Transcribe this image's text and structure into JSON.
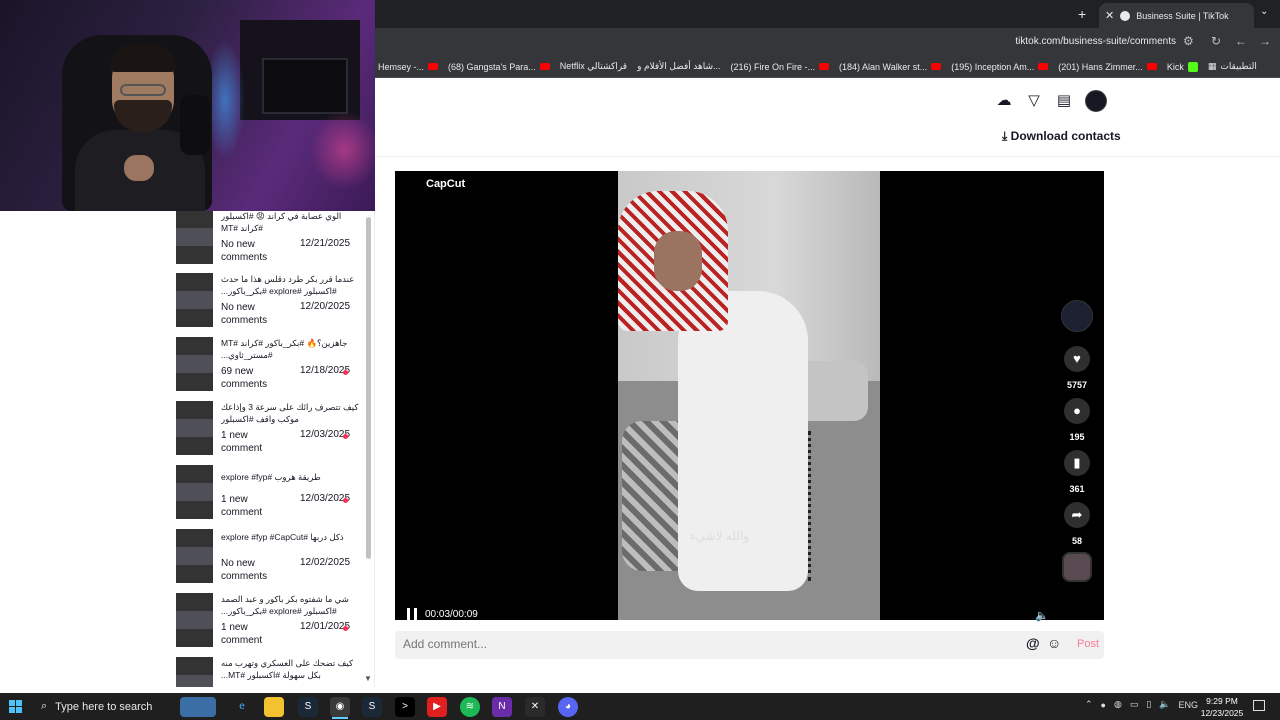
{
  "browser": {
    "tab_title": "Business Suite | TikTok",
    "url": "tiktok.com/business-suite/comments",
    "new_tab": "+",
    "close_tab": "✕",
    "bookmarks": [
      "Hemsey -...",
      "(68) Gangsta's Para...",
      "Netflix قراكشتالي",
      "شاهد أفضل الأفلام و...",
      "(216) Fire On Fire -...",
      "(184) Alan Walker st...",
      "(195) Inception Am...",
      "(201) Hans Zimmer...",
      "Kick",
      "التطبيقات"
    ]
  },
  "header": {
    "download_label": "Download contacts",
    "icons": [
      "upload-cloud-icon",
      "filter-icon",
      "message-icon",
      "profile-avatar"
    ]
  },
  "video_list": [
    {
      "title": "الوي عصابة في كراند 😡 #اكسبلور #كراند #MT",
      "comments": "No new comments",
      "date": "12/21/2025",
      "unread": false
    },
    {
      "title": "عندما قرر بكر طرد دقلس هذا ما حدث #اكسبلور #explore #بكر_باكور...",
      "comments": "No new comments",
      "date": "12/20/2025",
      "unread": false
    },
    {
      "title": "جاهزين؟🔥 #بكر_باكور #كراند #MT #مستر_ثاوي...",
      "comments": "69 new comments",
      "date": "12/18/2025",
      "unread": true
    },
    {
      "title": "كيف تتصرف رائك على سرعة 3 وإذاعك موكب واقف #اكسبلور",
      "comments": "1 new comment",
      "date": "12/03/2025",
      "unread": true
    },
    {
      "title": "طريقة هروب #explore #fyp",
      "comments": "1 new comment",
      "date": "12/03/2025",
      "unread": true
    },
    {
      "title": "ذكل دربها #explore #fyp #CapCut",
      "comments": "No new comments",
      "date": "12/02/2025",
      "unread": false
    },
    {
      "title": "شي ما شفتوه بكر باكور و عبد الصمد #اكسبلور #explore #بكر_باكور...",
      "comments": "1 new comment",
      "date": "12/01/2025",
      "unread": true
    },
    {
      "title": "كيف تضحك على العسكري وتهرب منه بكل سهولة #اكسبلور #MT...",
      "comments": "",
      "date": "",
      "unread": false
    }
  ],
  "player": {
    "watermark": "CapCut",
    "subtitle": "والله لاشيء",
    "time": "00:03/00:09",
    "likes": "5757",
    "comments": "195",
    "saves": "361",
    "shares": "58"
  },
  "comment_box": {
    "placeholder": "Add comment...",
    "at_label": "@",
    "post_label": "Post"
  },
  "taskbar": {
    "search_placeholder": "Type here to search",
    "lang": "ENG",
    "time": "9:29 PM",
    "date": "12/23/2025"
  }
}
